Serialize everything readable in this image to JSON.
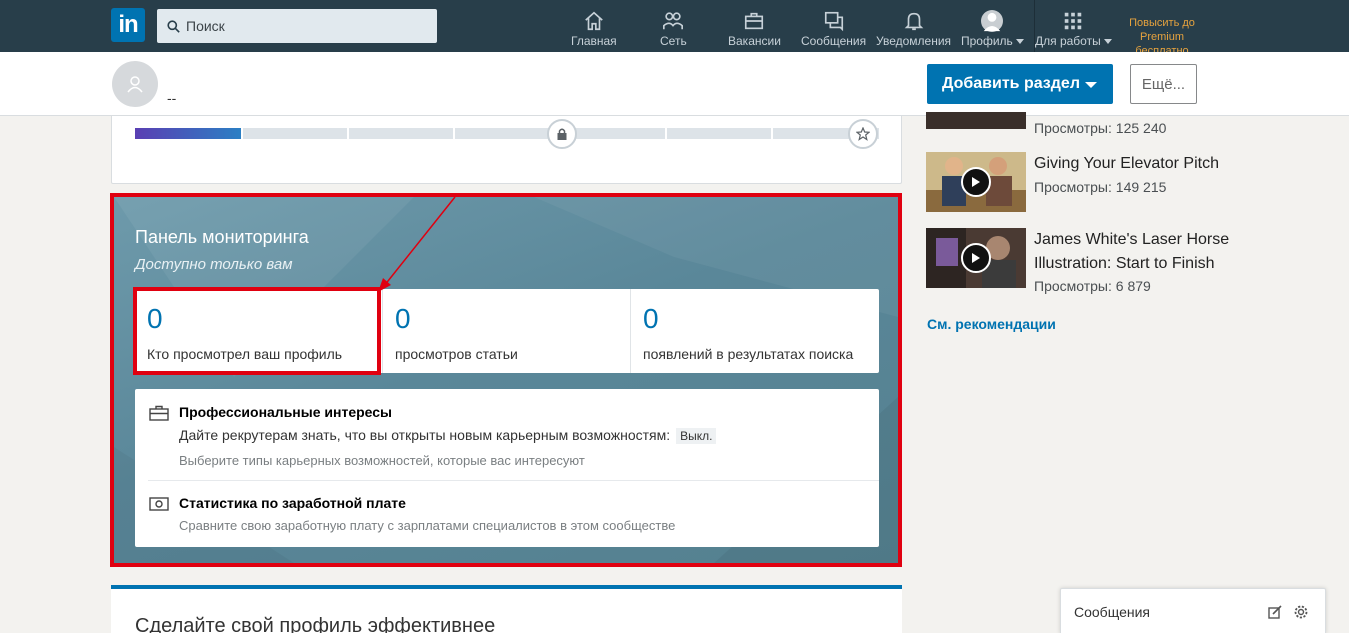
{
  "nav": {
    "logo_text": "in",
    "search_placeholder": "Поиск",
    "items": [
      {
        "label": "Главная",
        "icon": "home-icon"
      },
      {
        "label": "Сеть",
        "icon": "network-icon"
      },
      {
        "label": "Вакансии",
        "icon": "jobs-icon"
      },
      {
        "label": "Сообщения",
        "icon": "messaging-icon"
      },
      {
        "label": "Уведомления",
        "icon": "bell-icon"
      },
      {
        "label": "Профиль",
        "icon": "profile-avatar-icon"
      },
      {
        "label": "Для работы",
        "icon": "grid-icon"
      }
    ],
    "premium": "Повысить до Premium бесплатно",
    "premium_color": "#e7a33e",
    "background": "#283e4a"
  },
  "profile_header": {
    "name": "--",
    "add_section_label": "Добавить раздел",
    "more_label": "Ещё...",
    "accent": "#0073b1"
  },
  "profile_strength": {
    "filled_segments": 1,
    "total_segments": 7
  },
  "dashboard": {
    "title": "Панель мониторинга",
    "subtitle": "Доступно только вам",
    "stats": [
      {
        "value": "0",
        "label": "Кто просмотрел ваш профиль"
      },
      {
        "value": "0",
        "label": "просмотров статьи"
      },
      {
        "value": "0",
        "label": "появлений в результатах поиска"
      }
    ],
    "career_interests": {
      "title": "Профессиональные интересы",
      "text": "Дайте рекрутерам знать, что вы открыты новым карьерным возможностям:",
      "status": "Выкл.",
      "hint": "Выберите типы карьерных возможностей, которые вас интересуют"
    },
    "salary": {
      "title": "Статистика по заработной плате",
      "hint": "Сравните свою заработную плату с зарплатами специалистов в этом сообществе"
    },
    "highlight_color": "#e00010"
  },
  "bottom_card": {
    "title": "Сделайте свой профиль эффективнее"
  },
  "rail": {
    "items": [
      {
        "title": "",
        "views": "Просмотры: 125 240"
      },
      {
        "title": "Giving Your Elevator Pitch",
        "views": "Просмотры: 149 215"
      },
      {
        "title": "James White's Laser Horse Illustration: Start to Finish",
        "views": "Просмотры: 6 879"
      }
    ],
    "more_link": "См. рекомендации"
  },
  "messages_widget": {
    "label": "Сообщения"
  }
}
